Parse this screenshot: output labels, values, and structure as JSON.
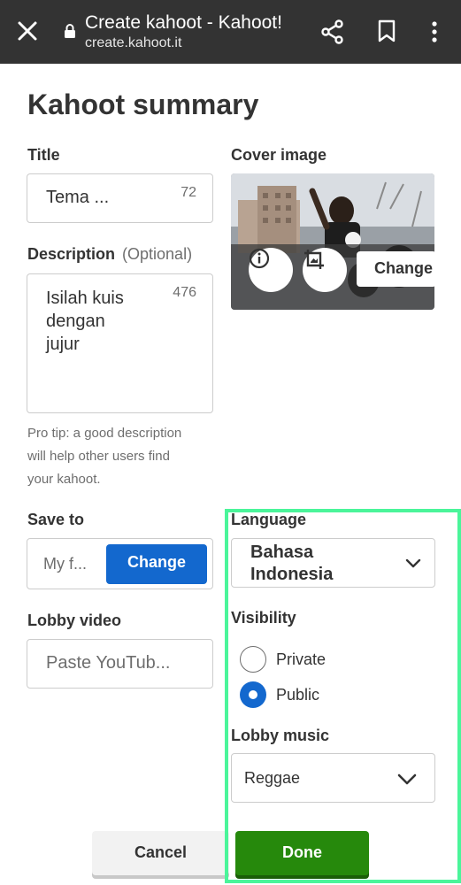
{
  "browser": {
    "page_title": "Create kahoot - Kahoot!",
    "url": "create.kahoot.it",
    "icons": [
      "close-icon",
      "lock-icon",
      "share-icon",
      "bookmark-icon",
      "more-icon"
    ]
  },
  "summary": {
    "heading": "Kahoot summary",
    "title": {
      "label": "Title",
      "value": "Tema ...",
      "counter": "72"
    },
    "description": {
      "label": "Description",
      "optional": "(Optional)",
      "lines": [
        "Isilah kuis",
        "dengan",
        "jujur"
      ],
      "counter": "476",
      "tip_lines": [
        "Pro tip: a good description",
        "will help other users find",
        "your kahoot."
      ]
    },
    "cover": {
      "label": "Cover image",
      "change_label": "Change",
      "icons": [
        "info-icon",
        "crop-image-icon"
      ]
    },
    "save_to": {
      "label": "Save to",
      "value": "My f...",
      "button": "Change"
    },
    "lobby_video": {
      "label": "Lobby video",
      "placeholder": "Paste YouTub..."
    },
    "language": {
      "label": "Language",
      "lines": [
        "Bahasa",
        "Indonesia"
      ],
      "icon": "chevron-down-icon"
    },
    "visibility": {
      "label": "Visibility",
      "options": [
        {
          "label": "Private",
          "selected": false
        },
        {
          "label": "Public",
          "selected": true
        }
      ]
    },
    "lobby_music": {
      "label": "Lobby music",
      "value": "Reggae",
      "icon": "chevron-down-icon"
    }
  },
  "actions": {
    "cancel": "Cancel",
    "done": "Done"
  },
  "colors": {
    "topbar": "#333333",
    "primary_blue": "#1368ce",
    "done_green": "#26890c",
    "highlight": "#4af59a"
  }
}
